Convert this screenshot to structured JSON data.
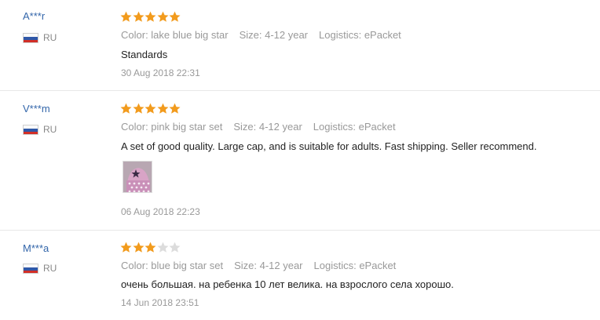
{
  "reviews": [
    {
      "user": "A***r",
      "country": "RU",
      "rating": 5,
      "color": "Color: lake blue big star",
      "size": "Size: 4-12 year",
      "logistics": "Logistics: ePacket",
      "text": "Standards",
      "date": "30 Aug 2018 22:31"
    },
    {
      "user": "V***m",
      "country": "RU",
      "rating": 5,
      "color": "Color: pink big star set",
      "size": "Size: 4-12 year",
      "logistics": "Logistics: ePacket",
      "text": "A set of good quality. Large cap, and is suitable for adults. Fast shipping. Seller recommend.",
      "date": "06 Aug 2018 22:23"
    },
    {
      "user": "M***a",
      "country": "RU",
      "rating": 3,
      "color": "Color: blue big star set",
      "size": "Size: 4-12 year",
      "logistics": "Logistics: ePacket",
      "text": "очень большая. на ребенка 10 лет велика. на взрослого села хорошо.",
      "date": "14 Jun 2018 23:51"
    }
  ],
  "star_max": 5,
  "colors": {
    "star_on": "#f29b1d",
    "star_off": "#dcdcdc",
    "user_link": "#3366aa"
  }
}
